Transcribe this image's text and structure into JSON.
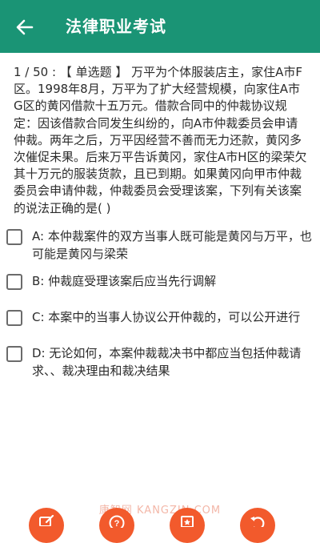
{
  "appbar": {
    "title": "法律职业考试",
    "back_icon": "arrow-left-icon"
  },
  "question": {
    "text": "1 / 50 : 【 单选题 】 万平为个体服装店主，家住A市F区。1998年8月，万平为了扩大经营规模，向家住A市G区的黄冈借款十五万元。借款合同中的仲裁协议规定：因该借款合同发生纠纷的，向A市仲裁委员会申请仲裁。两年之后，万平因经营不善而无力还款，黄冈多次催促未果。后来万平告诉黄冈，家住A市H区的梁荣欠其十万元的服装货款，且已到期。如果黄冈向甲市仲裁委员会申请仲裁，仲裁委员会受理该案，下列有关该案的说法正确的是( )"
  },
  "options": [
    {
      "label": "A:  本仲裁案件的双方当事人既可能是黄冈与万平，也可能是黄冈与梁荣",
      "checked": false
    },
    {
      "label": "B:  仲裁庭受理该案后应当先行调解",
      "checked": false
    },
    {
      "label": "C:  本案中的当事人协议公开仲裁的，可以公开进行",
      "checked": false
    },
    {
      "label": "D:  无论如何，本案仲裁裁决书中都应当包括仲裁请求、、裁决理由和裁决结果",
      "checked": false
    }
  ],
  "watermark": "康智网 KANGZIN.COM",
  "bottom_buttons": [
    "edit-icon",
    "help-icon",
    "bookmark-icon",
    "undo-icon"
  ],
  "colors": {
    "appbar": "#1a9475",
    "fab": "#f25a2c"
  }
}
